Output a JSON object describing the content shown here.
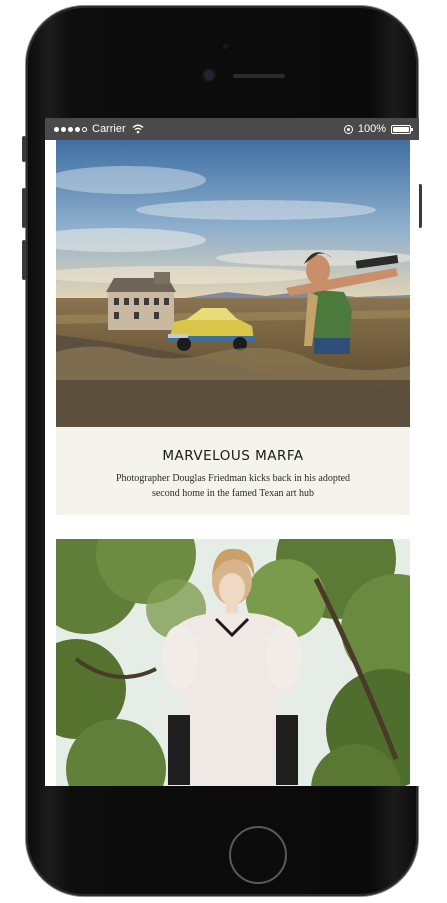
{
  "status_bar": {
    "carrier": "Carrier",
    "battery": "100%",
    "signal_bars_filled": 4,
    "signal_bars_total": 5,
    "battery_level": 1.0
  },
  "articles": [
    {
      "title": "MARVELOUS MARFA",
      "subtitle": "Photographer Douglas Friedman kicks back in his adopted second home in the famed Texan art hub"
    }
  ],
  "colors": {
    "status_bar_bg": "#4a4a4a",
    "caption_bg": "#f4f4ec",
    "phone_body": "#0b0b0b"
  },
  "icons": [
    "signal-icon",
    "wifi-icon",
    "lock-icon",
    "battery-icon",
    "home-button",
    "camera-icon"
  ]
}
